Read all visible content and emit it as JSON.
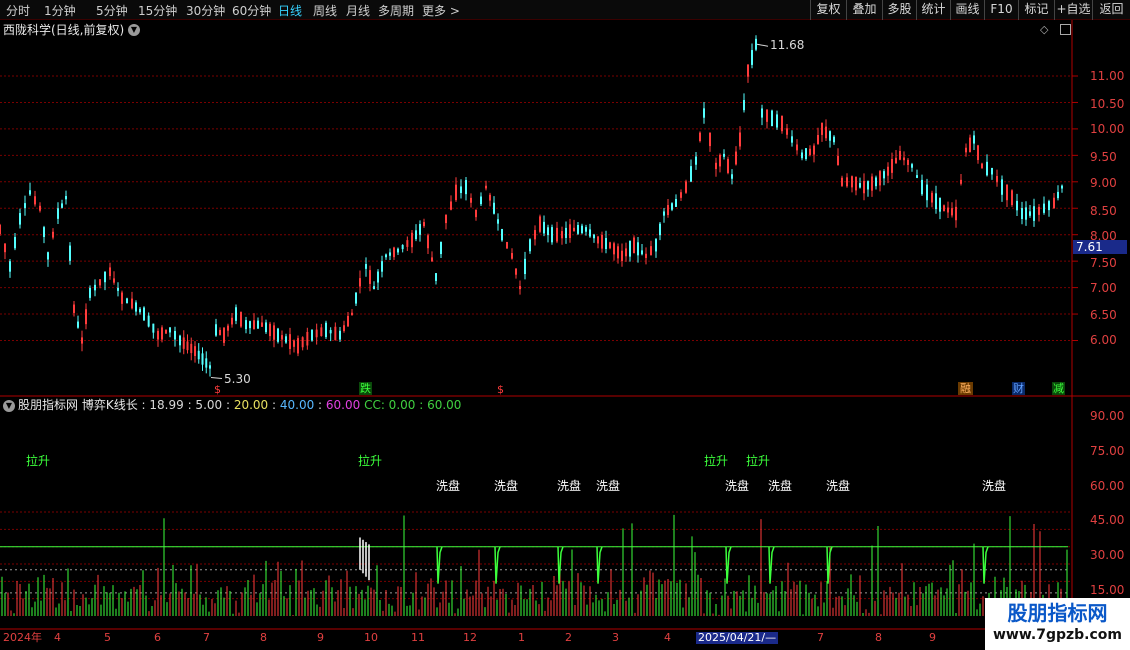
{
  "toolbar": {
    "periods": [
      "分时",
      "1分钟",
      "5分钟",
      "15分钟",
      "30分钟",
      "60分钟",
      "日线",
      "周线",
      "月线",
      "多周期",
      "更多 >"
    ],
    "active_period": "日线",
    "actions": [
      "复权",
      "叠加",
      "多股",
      "统计",
      "画线",
      "F10",
      "标记",
      "+自选",
      "返回"
    ]
  },
  "main_chart": {
    "title": "西陇科学(日线,前复权)",
    "y_ticks": [
      "11.00",
      "10.50",
      "10.00",
      "9.50",
      "9.00",
      "8.50",
      "8.00",
      "7.50",
      "7.00",
      "6.50",
      "6.00"
    ],
    "current_price": "7.61",
    "high_label": "11.68",
    "low_label": "5.30",
    "event_markers": [
      "跌",
      "$",
      "$",
      "融",
      "财",
      "减"
    ]
  },
  "indicator": {
    "source": "股朋指标网",
    "name": "博弈K线长",
    "readout": [
      {
        "text": ": 18.99 : 5.00 :",
        "color": "#d8d8d8"
      },
      {
        "text": "20.00",
        "color": "#e8e060"
      },
      {
        "text": ":",
        "color": "#d8d8d8"
      },
      {
        "text": "40.00",
        "color": "#58b8ff"
      },
      {
        "text": ":",
        "color": "#d8d8d8"
      },
      {
        "text": "60.00",
        "color": "#e040e0"
      },
      {
        "text": "CC: 0.00 : 60.00",
        "color": "#40d040"
      }
    ],
    "y_ticks": [
      "90.00",
      "75.00",
      "60.00",
      "45.00",
      "30.00",
      "15.00"
    ],
    "signal_labels": {
      "rise": "拉升",
      "wash": "洗盘"
    }
  },
  "date_axis": {
    "labels": [
      "2024年",
      "4",
      "5",
      "6",
      "7",
      "8",
      "9",
      "10",
      "11",
      "12",
      "1",
      "2",
      "3",
      "4",
      "2025/04/21/—",
      "7",
      "8",
      "9"
    ]
  },
  "watermark": {
    "title": "股朋指标网",
    "url": "www.7gpzb.com"
  },
  "colors": {
    "up": "#ff3c3c",
    "down": "#54ffff",
    "grid": "#7a0000",
    "green": "#3cff3c",
    "white": "#ffffff"
  }
}
